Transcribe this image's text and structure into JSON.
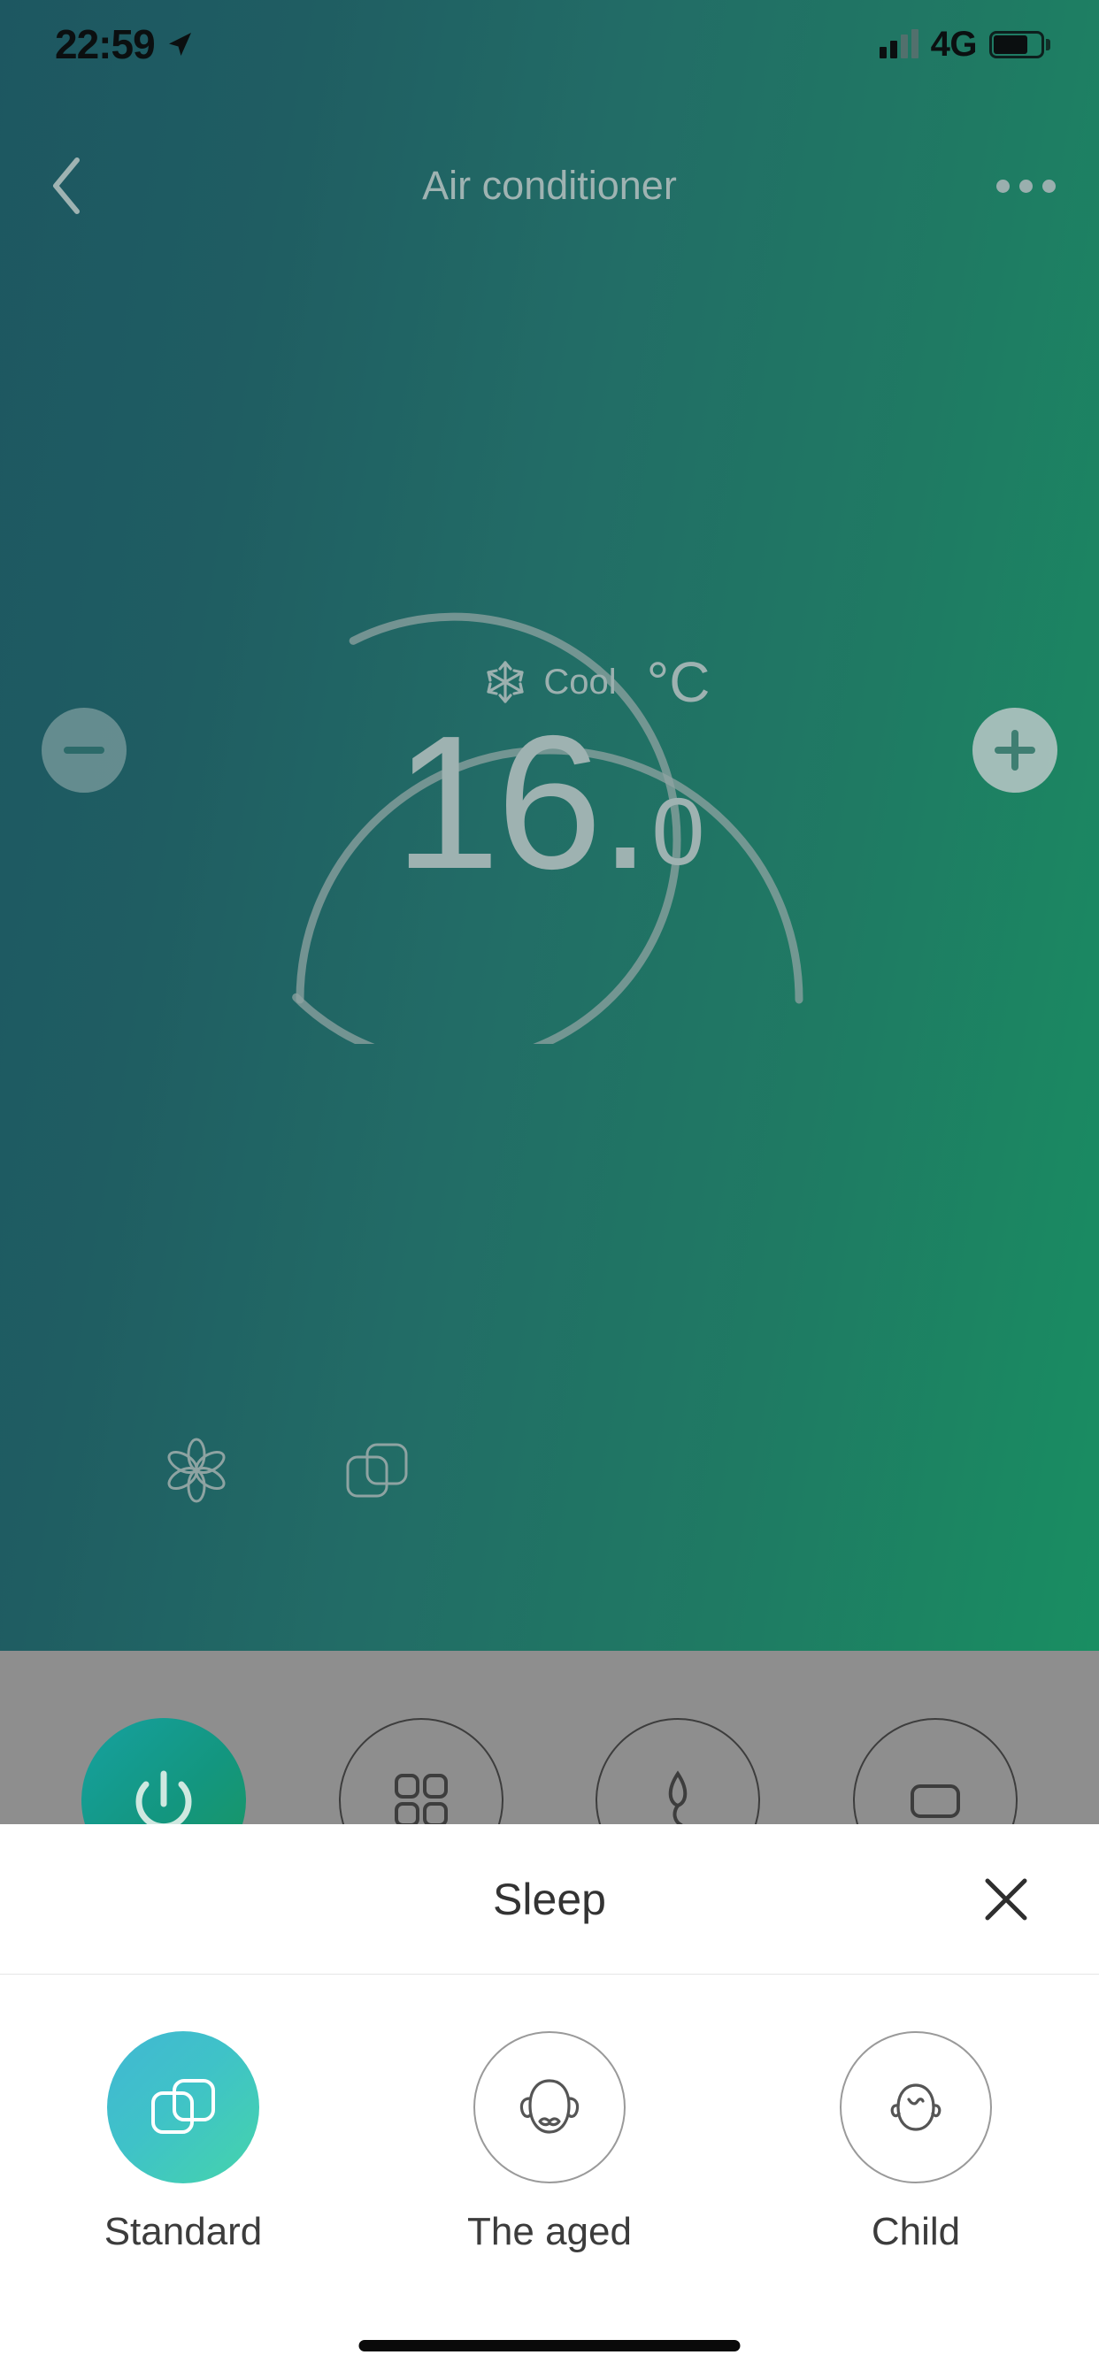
{
  "status_bar": {
    "time": "22:59",
    "location_icon": "location-arrow-icon",
    "signal_icon": "signal-bars-icon",
    "network": "4G",
    "battery_icon": "battery-icon"
  },
  "header": {
    "back_icon": "chevron-left-icon",
    "title": "Air conditioner",
    "more_icon": "more-horizontal-icon"
  },
  "climate": {
    "mode_icon": "snowflake-icon",
    "mode_label": "Cool",
    "temperature_integer": "16",
    "temperature_separator": ".",
    "temperature_decimal": "0",
    "unit": "°C",
    "decrease_label": "−",
    "increase_label": "+",
    "decrease_name": "decrease-temperature-button",
    "increase_name": "increase-temperature-button"
  },
  "features": [
    {
      "icon": "fan-speed-icon",
      "name": "fan-speed-button"
    },
    {
      "icon": "sleep-mode-icon",
      "name": "sleep-mode-button"
    }
  ],
  "controls": [
    {
      "icon": "power-icon",
      "name": "power-button",
      "active": true
    },
    {
      "icon": "function-grid-icon",
      "name": "functions-button",
      "active": false
    },
    {
      "icon": "mode-leaf-icon",
      "name": "mode-button",
      "active": false
    },
    {
      "icon": "display-icon",
      "name": "display-button",
      "active": false
    }
  ],
  "sheet": {
    "title": "Sleep",
    "close_icon": "close-icon",
    "close_label": "✕",
    "options": [
      {
        "label": "Standard",
        "icon": "layers-icon",
        "selected": true
      },
      {
        "label": "The aged",
        "icon": "elderly-face-icon",
        "selected": false
      },
      {
        "label": "Child",
        "icon": "child-face-icon",
        "selected": false
      }
    ]
  },
  "colors": {
    "bg_start": "#1d5761",
    "bg_end": "#198e62",
    "accent": "#45d4ab",
    "selected_gradient_start": "#41b8d3",
    "dim_overlay": "#8e8e8e",
    "muted_text": "#9eb2b1"
  },
  "home_indicator": "home-indicator"
}
